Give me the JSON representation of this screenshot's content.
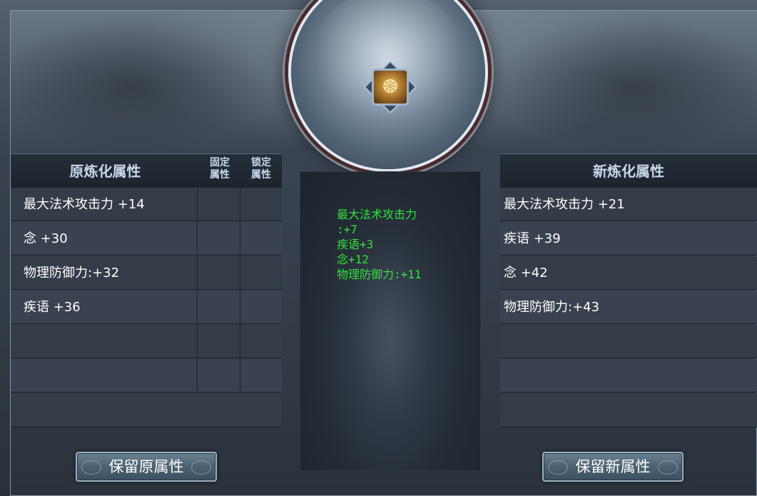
{
  "original_panel": {
    "title": "原炼化属性",
    "col_fixed": [
      "固定",
      "属性"
    ],
    "col_locked": [
      "锁定",
      "属性"
    ],
    "rows": [
      "最大法术攻击力 +14",
      "念 +30",
      "物理防御力:+32",
      "疾语 +36",
      "",
      ""
    ],
    "button": "保留原属性"
  },
  "new_panel": {
    "title": "新炼化属性",
    "rows": [
      "最大法术攻击力 +21",
      "疾语 +39",
      "念 +42",
      "物理防御力:+43",
      "",
      ""
    ],
    "button": "保留新属性"
  },
  "preview": {
    "lines": [
      "最大法术攻击力",
      ":+7",
      "疾语+3",
      "念+12",
      "物理防御力:+11"
    ],
    "text_color": "#31e23a"
  },
  "item": {
    "icon": "refine-item-icon"
  },
  "colors": {
    "title_text": "#c9d6ea",
    "button_border": "#9fb1c0"
  }
}
